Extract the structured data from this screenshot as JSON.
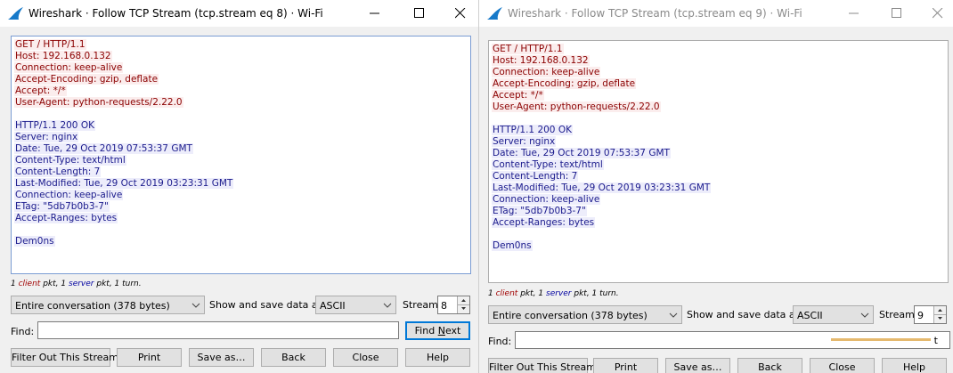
{
  "windows": [
    {
      "title": "Wireshark · Follow TCP Stream (tcp.stream eq 8) · Wi-Fi",
      "client_lines": [
        "GET / HTTP/1.1",
        "Host: 192.168.0.132",
        "Connection: keep-alive",
        "Accept-Encoding: gzip, deflate",
        "Accept: */*",
        "User-Agent: python-requests/2.22.0"
      ],
      "server_lines": [
        "HTTP/1.1 200 OK",
        "Server: nginx",
        "Date: Tue, 29 Oct 2019 07:53:37 GMT",
        "Content-Type: text/html",
        "Content-Length: 7",
        "Last-Modified: Tue, 29 Oct 2019 03:23:31 GMT",
        "Connection: keep-alive",
        "ETag: \"5db7b0b3-7\"",
        "Accept-Ranges: bytes"
      ],
      "body_lines": [
        "Dem0ns"
      ],
      "summary": {
        "n_client": "1",
        "client_word": "client",
        "pkt1": " pkt, ",
        "n_server": "1",
        "server_word": "server",
        "pkt2": " pkt, 1 turn."
      },
      "conversation": "Entire conversation (378 bytes)",
      "show_save_label": "Show and save data as",
      "format": "ASCII",
      "stream_label": "Stream",
      "stream_value": "8",
      "find_label": "Find:",
      "find_value": "",
      "find_next_prefix": "Find ",
      "find_next_u": "N",
      "find_next_suffix": "ext",
      "buttons": {
        "filter": "Filter Out This Stream",
        "print": "Print",
        "save": "Save as…",
        "back": "Back",
        "close": "Close",
        "help": "Help"
      }
    },
    {
      "title": "Wireshark · Follow TCP Stream (tcp.stream eq 9) · Wi-Fi",
      "client_lines": [
        "GET / HTTP/1.1",
        "Host: 192.168.0.132",
        "Connection: keep-alive",
        "Accept-Encoding: gzip, deflate",
        "Accept: */*",
        "User-Agent: python-requests/2.22.0"
      ],
      "server_lines": [
        "HTTP/1.1 200 OK",
        "Server: nginx",
        "Date: Tue, 29 Oct 2019 07:53:37 GMT",
        "Content-Type: text/html",
        "Content-Length: 7",
        "Last-Modified: Tue, 29 Oct 2019 03:23:31 GMT",
        "Connection: keep-alive",
        "ETag: \"5db7b0b3-7\"",
        "Accept-Ranges: bytes"
      ],
      "body_lines": [
        "Dem0ns"
      ],
      "summary": {
        "n_client": "1",
        "client_word": "client",
        "pkt1": " pkt, ",
        "n_server": "1",
        "server_word": "server",
        "pkt2": " pkt, 1 turn."
      },
      "conversation": "Entire conversation (378 bytes)",
      "show_save_label": "Show and save data as",
      "format": "ASCII",
      "stream_label": "Stream",
      "stream_value": "9",
      "find_label": "Find:",
      "find_value": "",
      "find_next_tail": "t",
      "buttons": {
        "filter": "Filter Out This Stream",
        "print": "Print",
        "save": "Save as…",
        "back": "Back",
        "close": "Close",
        "help": "Help"
      }
    }
  ],
  "colors": {
    "client_text": "#8b0000",
    "server_text": "#1a1a8c",
    "focus_border": "#0078d7"
  }
}
